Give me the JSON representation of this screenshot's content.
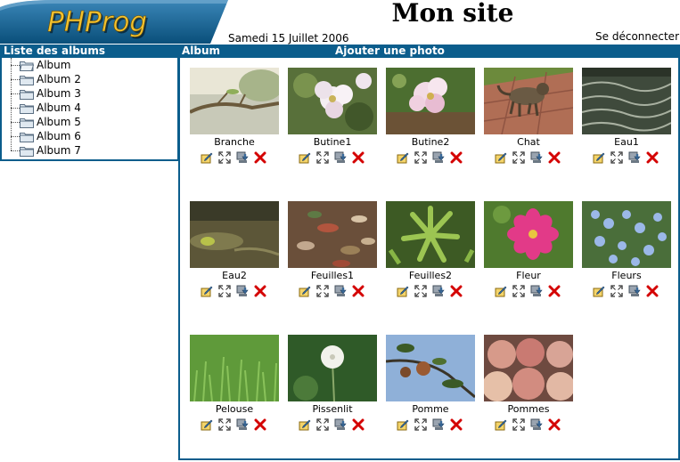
{
  "header": {
    "logo_text": "PHProg",
    "site_title": "Mon site",
    "date": "Samedi 15 Juillet 2006",
    "logout_label": "Se déconnecter"
  },
  "albums_panel": {
    "title": "Liste des albums",
    "items": [
      {
        "label": "Album",
        "icon": "folder-open-icon"
      },
      {
        "label": "Album 2",
        "icon": "folder-icon"
      },
      {
        "label": "Album 3",
        "icon": "folder-icon"
      },
      {
        "label": "Album 4",
        "icon": "folder-icon"
      },
      {
        "label": "Album 5",
        "icon": "folder-icon"
      },
      {
        "label": "Album 6",
        "icon": "folder-icon"
      },
      {
        "label": "Album 7",
        "icon": "folder-icon"
      }
    ]
  },
  "gallery": {
    "title": "Album",
    "add_photo_label": "Ajouter une photo",
    "photos": [
      {
        "caption": "Branche"
      },
      {
        "caption": "Butine1"
      },
      {
        "caption": "Butine2"
      },
      {
        "caption": "Chat"
      },
      {
        "caption": "Eau1"
      },
      {
        "caption": "Eau2"
      },
      {
        "caption": "Feuilles1"
      },
      {
        "caption": "Feuilles2"
      },
      {
        "caption": "Fleur"
      },
      {
        "caption": "Fleurs"
      },
      {
        "caption": "Pelouse"
      },
      {
        "caption": "Pissenlit"
      },
      {
        "caption": "Pomme"
      },
      {
        "caption": "Pommes"
      }
    ],
    "action_icons": [
      "edit-icon",
      "fullscreen-icon",
      "download-icon",
      "delete-icon"
    ]
  },
  "colors": {
    "accent": "#0b5d8c",
    "logo_text": "#f2c230",
    "delete": "#d40000"
  }
}
